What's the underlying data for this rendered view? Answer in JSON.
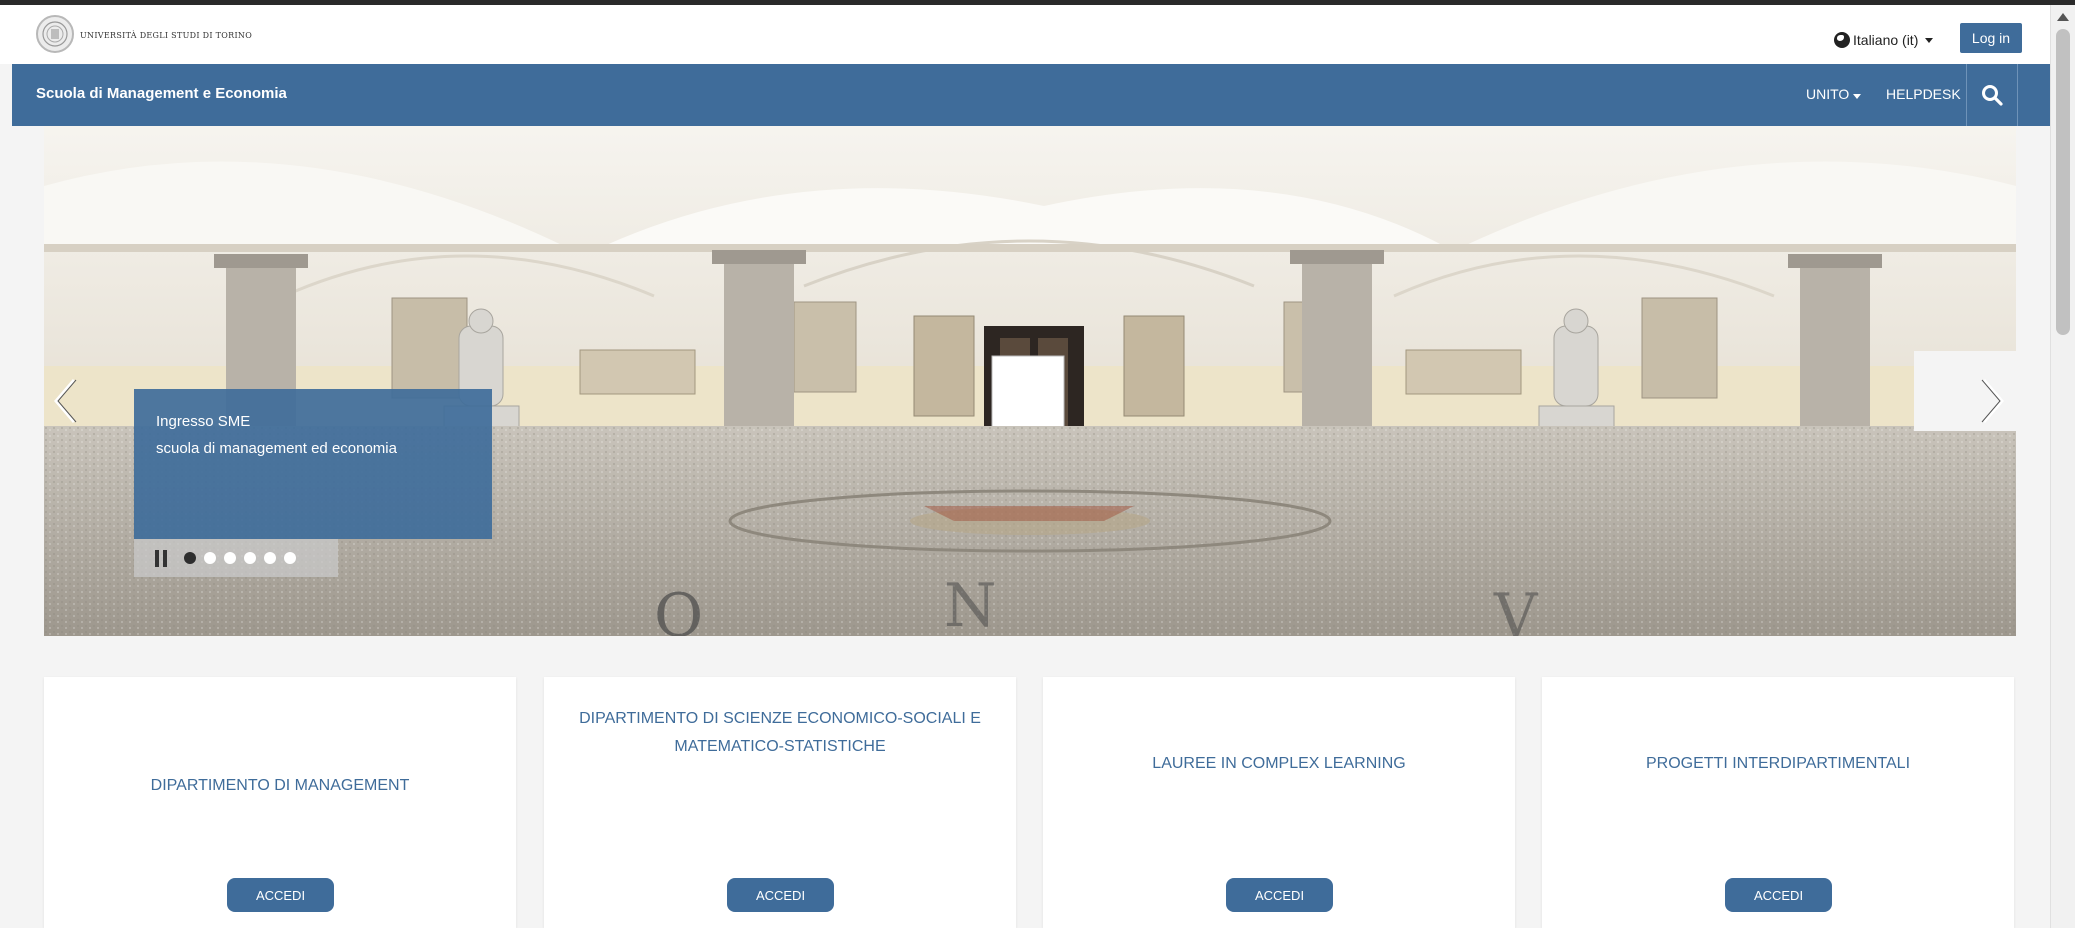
{
  "header": {
    "university_name": "UNIVERSITÀ DEGLI STUDI DI TORINO",
    "language_label": "Italiano (it)",
    "login_label": "Log in"
  },
  "navbar": {
    "site_title": "Scuola di Management e Economia",
    "unito_label": "UNITO",
    "helpdesk_label": "HELPDESK"
  },
  "carousel": {
    "caption_title": "Ingresso SME",
    "caption_text": "scuola di management ed economia",
    "slide_count": 6,
    "active_slide": 1
  },
  "cards": [
    {
      "title": "DIPARTIMENTO DI MANAGEMENT",
      "button_label": "ACCEDI"
    },
    {
      "title": "DIPARTIMENTO DI SCIENZE ECONOMICO-SOCIALI E MATEMATICO-STATISTICHE",
      "button_label": "ACCEDI"
    },
    {
      "title": "LAUREE IN COMPLEX LEARNING",
      "button_label": "ACCEDI"
    },
    {
      "title": "PROGETTI INTERDIPARTIMENTALI",
      "button_label": "ACCEDI"
    }
  ],
  "colors": {
    "brand_blue": "#3f6c9a",
    "page_background": "#f4f4f4"
  },
  "icons": {
    "logo": "university-seal-icon",
    "language": "globe-icon",
    "search": "search-icon",
    "carousel_prev": "chevron-left-icon",
    "carousel_next": "chevron-right-icon",
    "pause": "pause-icon"
  }
}
